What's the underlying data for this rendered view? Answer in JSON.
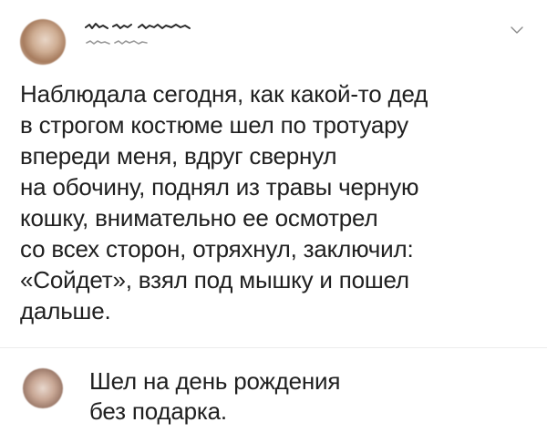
{
  "post": {
    "avatar_icon": "user-avatar-icon",
    "menu_icon": "chevron-down-icon",
    "text": "Наблюдала сегодня, как какой-то дед\nв строгом костюме шел по тротуару\nвпереди меня, вдруг свернул\nна обочину, поднял из травы черную\nкошку, внимательно ее осмотрел\nсо всех сторон, отряхнул, заключил:\n«Сойдет», взял под мышку и пошел\nдальше."
  },
  "reply": {
    "avatar_icon": "user-avatar-icon",
    "text": "Шел на день рождения\nбез подарка."
  },
  "colors": {
    "text": "#202020",
    "divider": "#ececec",
    "chevron": "#8a8a8a",
    "background": "#ffffff"
  }
}
